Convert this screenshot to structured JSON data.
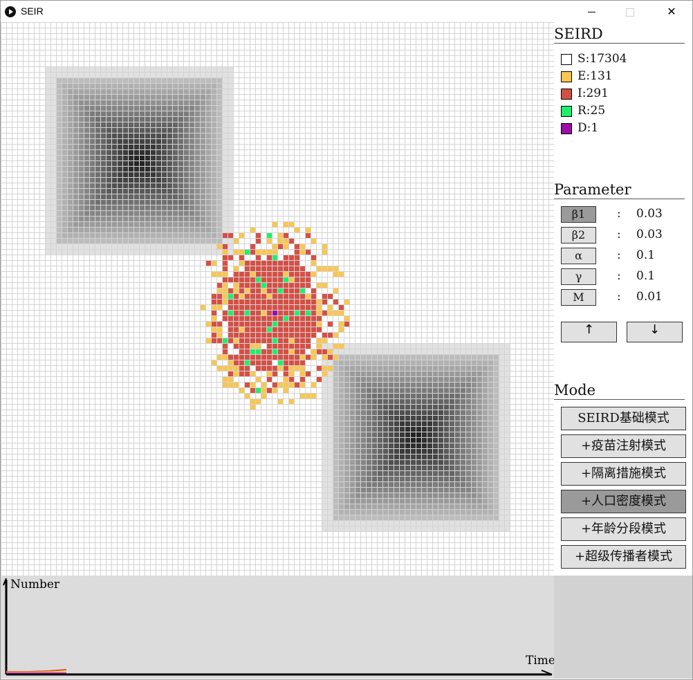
{
  "window": {
    "title": "SEIR"
  },
  "legend": {
    "title": "SEIRD",
    "items": [
      {
        "label": "S:17304",
        "color": "#ffffff",
        "name": "legend-susceptible"
      },
      {
        "label": "E:131",
        "color": "#f9c74f",
        "name": "legend-exposed"
      },
      {
        "label": "I:291",
        "color": "#d64f45",
        "name": "legend-infected"
      },
      {
        "label": "R:25",
        "color": "#1ef06a",
        "name": "legend-recovered"
      },
      {
        "label": "D:1",
        "color": "#9b0fa8",
        "name": "legend-dead"
      }
    ]
  },
  "parameters": {
    "title": "Parameter",
    "items": [
      {
        "symbol": "β1",
        "colon": ":",
        "value": "0.03",
        "selected": true,
        "name": "beta1"
      },
      {
        "symbol": "β2",
        "colon": ":",
        "value": "0.03",
        "selected": false,
        "name": "beta2"
      },
      {
        "symbol": "α",
        "colon": ":",
        "value": "0.1",
        "selected": false,
        "name": "alpha"
      },
      {
        "symbol": "γ",
        "colon": ":",
        "value": "0.1",
        "selected": false,
        "name": "gamma"
      },
      {
        "symbol": "M",
        "colon": ":",
        "value": "0.01",
        "selected": false,
        "name": "m"
      }
    ],
    "increase_label": "↑",
    "decrease_label": "↓"
  },
  "mode": {
    "title": "Mode",
    "buttons": [
      {
        "label": "SEIRD基础模式",
        "active": false,
        "name": "mode-seird-basic-button"
      },
      {
        "label": "+疫苗注射模式",
        "active": false,
        "name": "mode-vaccine-button"
      },
      {
        "label": "+隔离措施模式",
        "active": false,
        "name": "mode-quarantine-button"
      },
      {
        "label": "+人口密度模式",
        "active": true,
        "name": "mode-population-density-button"
      },
      {
        "label": "+年龄分段模式",
        "active": false,
        "name": "mode-age-group-button"
      },
      {
        "label": "+超级传播者模式",
        "active": false,
        "name": "mode-superspreader-button"
      }
    ]
  },
  "chart": {
    "ylabel": "Number",
    "xlabel": "Time"
  },
  "colors": {
    "grid_line": "#d3d3d3",
    "exposed": "#f9c74f",
    "infected": "#d64f45",
    "recovered": "#1ef06a",
    "dead": "#9b0fa8",
    "selected_button": "#9a9a9a",
    "button": "#e1e1e1"
  }
}
